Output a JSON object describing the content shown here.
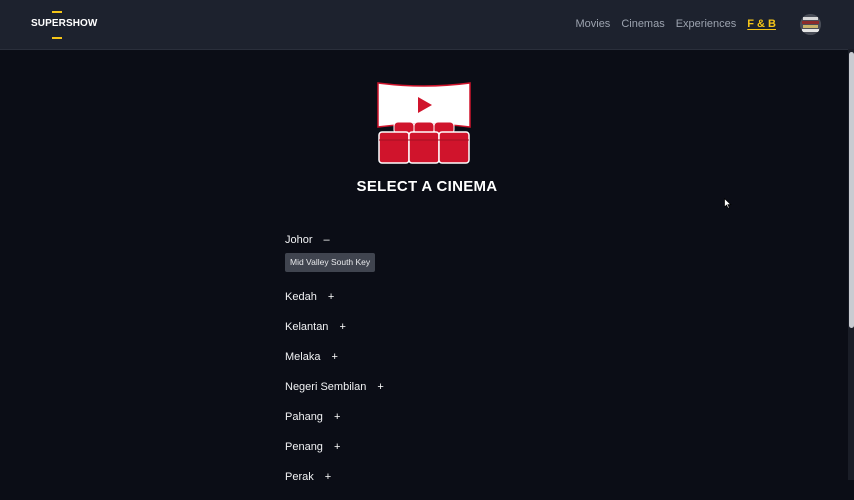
{
  "brand": {
    "name": "SUPERSHOW",
    "accent": "#f5c518"
  },
  "nav": {
    "links": [
      {
        "label": "Movies",
        "active": false
      },
      {
        "label": "Cinemas",
        "active": false
      },
      {
        "label": "Experiences",
        "active": false
      },
      {
        "label": "F & B",
        "active": true
      }
    ],
    "avatar_icon": "user-avatar-icon"
  },
  "page": {
    "title": "SELECT A CINEMA",
    "icon": "cinema-screen-seats-icon"
  },
  "regions": [
    {
      "name": "Johor",
      "toggle": "–",
      "expanded": true,
      "branches": [
        "Mid Valley South Key"
      ]
    },
    {
      "name": "Kedah",
      "toggle": "+",
      "expanded": false
    },
    {
      "name": "Kelantan",
      "toggle": "+",
      "expanded": false
    },
    {
      "name": "Melaka",
      "toggle": "+",
      "expanded": false
    },
    {
      "name": "Negeri Sembilan",
      "toggle": "+",
      "expanded": false
    },
    {
      "name": "Pahang",
      "toggle": "+",
      "expanded": false
    },
    {
      "name": "Penang",
      "toggle": "+",
      "expanded": false
    },
    {
      "name": "Perak",
      "toggle": "+",
      "expanded": false
    }
  ]
}
